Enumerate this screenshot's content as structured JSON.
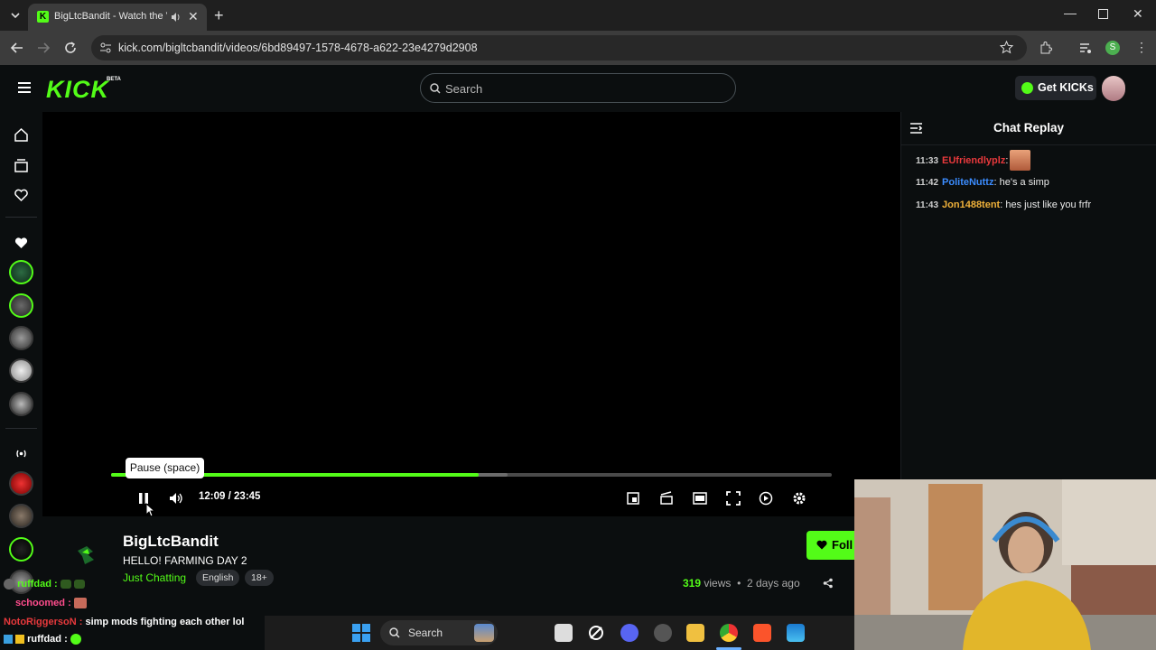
{
  "browser": {
    "tab_title": "BigLtcBandit - Watch the V",
    "url": "kick.com/bigltcbandit/videos/6bd89497-1578-4678-a622-23e4279d2908",
    "profile_initial": "S"
  },
  "header": {
    "logo": "KICK",
    "beta": "BETA",
    "search_placeholder": "Search",
    "get_kicks": "Get KICKs"
  },
  "player": {
    "tooltip": "Pause (space)",
    "current_time": "12:09",
    "separator": "/",
    "duration": "23:45",
    "progress_fraction": 0.51,
    "buffered_fraction": 0.55
  },
  "video_info": {
    "channel_name": "BigLtcBandit",
    "title": "HELLO! FARMING DAY 2",
    "category": "Just Chatting",
    "tags": [
      "English",
      "18+"
    ],
    "views_count": "319",
    "views_label": "views",
    "dot": "•",
    "posted": "2 days ago",
    "follow_label": "Foll"
  },
  "chat": {
    "header": "Chat Replay",
    "messages": [
      {
        "time": "11:33",
        "user": "EUfriendlyplz",
        "color": "#e8393c",
        "text": ""
      },
      {
        "time": "11:42",
        "user": "PoliteNuttz",
        "color": "#3b8cff",
        "text": "he's a simp"
      },
      {
        "time": "11:43",
        "user": "Jon1488tent",
        "color": "#f0b13a",
        "text": "hes just like you frfr"
      }
    ]
  },
  "overlay_chat": [
    {
      "user": "ruffdad :",
      "color": "#53fc18",
      "text": ""
    },
    {
      "user": "schoomed :",
      "color": "#ff4d8d",
      "text": ""
    },
    {
      "user": "NotoRiggersoN :",
      "color": "#e8393c",
      "text": "simp mods fighting each other lol"
    },
    {
      "user": "ruffdad :",
      "color": "#ffffff",
      "text": ""
    }
  ],
  "taskbar": {
    "search_label": "Search"
  },
  "colors": {
    "accent": "#53fc18",
    "background": "#0b0e0f"
  }
}
